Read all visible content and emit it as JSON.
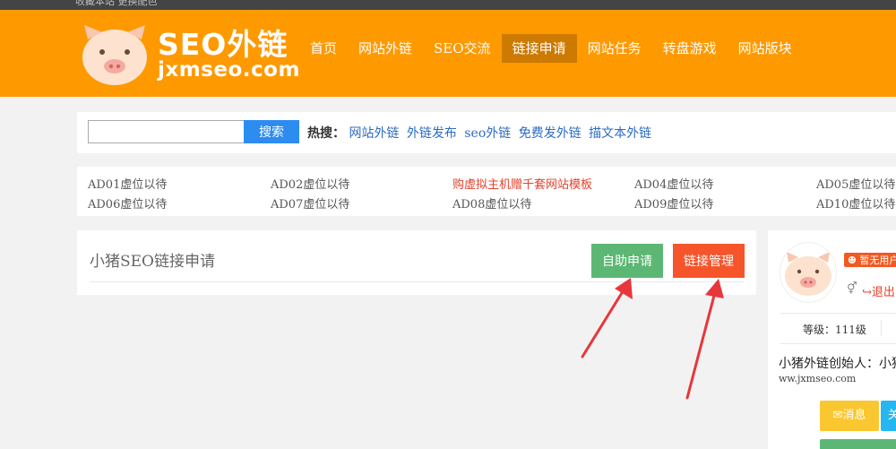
{
  "topbar": {
    "text": "收藏本站  更换配色"
  },
  "header": {
    "logo_title": "SEO外链",
    "logo_domain": "jxmseo.com",
    "nav": [
      "首页",
      "网站外链",
      "SEO交流",
      "链接申请",
      "网站任务",
      "转盘游戏",
      "网站版块"
    ],
    "active_nav": "链接申请"
  },
  "search": {
    "value": "",
    "button_label": "搜索",
    "hot_label": "热搜：",
    "hot_links": [
      "网站外链",
      "外链发布",
      "seo外链",
      "免费发外链",
      "描文本外链"
    ]
  },
  "ads": {
    "row1": [
      "AD01虚位以待",
      "AD02虚位以待",
      "购虚拟主机赠千套网站模板",
      "AD04虚位以待",
      "AD05虚位以待"
    ],
    "row2": [
      "AD06虚位以待",
      "AD07虚位以待",
      "AD08虚位以待",
      "AD09虚位以待",
      "AD10虚位以待"
    ]
  },
  "panel": {
    "title": "小猪SEO链接申请",
    "apply_button": "自助申请",
    "manage_button": "链接管理"
  },
  "sidebar": {
    "badge": "暂无用户",
    "gender_symbol": "⚥",
    "logout": "退出",
    "level": "等级：111级",
    "founder": "小猪外链创始人：小猪外链",
    "site": "ww.jxmseo.com",
    "message_button": "消息",
    "blue_button": "关注"
  },
  "colors": {
    "header": "#ff9900",
    "active_nav": "#cc7a00",
    "search_button": "#2d8cf0",
    "apply_button": "#5db774",
    "manage_button": "#f6552b",
    "annotation_arrow": "#e8363a"
  }
}
